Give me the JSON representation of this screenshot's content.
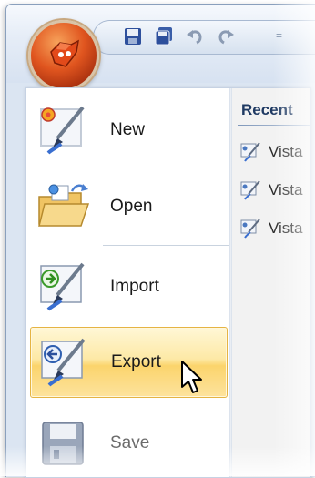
{
  "quick_access": {
    "buttons": [
      {
        "name": "save-icon"
      },
      {
        "name": "save-all-icon"
      },
      {
        "name": "undo-icon"
      },
      {
        "name": "redo-icon"
      }
    ],
    "more_glyph": "="
  },
  "orb": {
    "icon": "office-orb-logo"
  },
  "menu": {
    "items": [
      {
        "label": "New",
        "icon": "new-document-icon",
        "state": "normal"
      },
      {
        "label": "Open",
        "icon": "open-folder-icon",
        "state": "normal"
      },
      {
        "label": "Import",
        "icon": "import-icon",
        "state": "normal"
      },
      {
        "label": "Export",
        "icon": "export-icon",
        "state": "hover"
      },
      {
        "label": "Save",
        "icon": "save-disk-icon",
        "state": "disabled"
      }
    ]
  },
  "recent": {
    "title": "Recent",
    "items": [
      {
        "label": "Vista"
      },
      {
        "label": "Vista"
      },
      {
        "label": "Vista"
      }
    ]
  },
  "colors": {
    "hover_highlight": "#fbd46c",
    "title_text": "#1f3a63",
    "orb": "#e0551f"
  }
}
